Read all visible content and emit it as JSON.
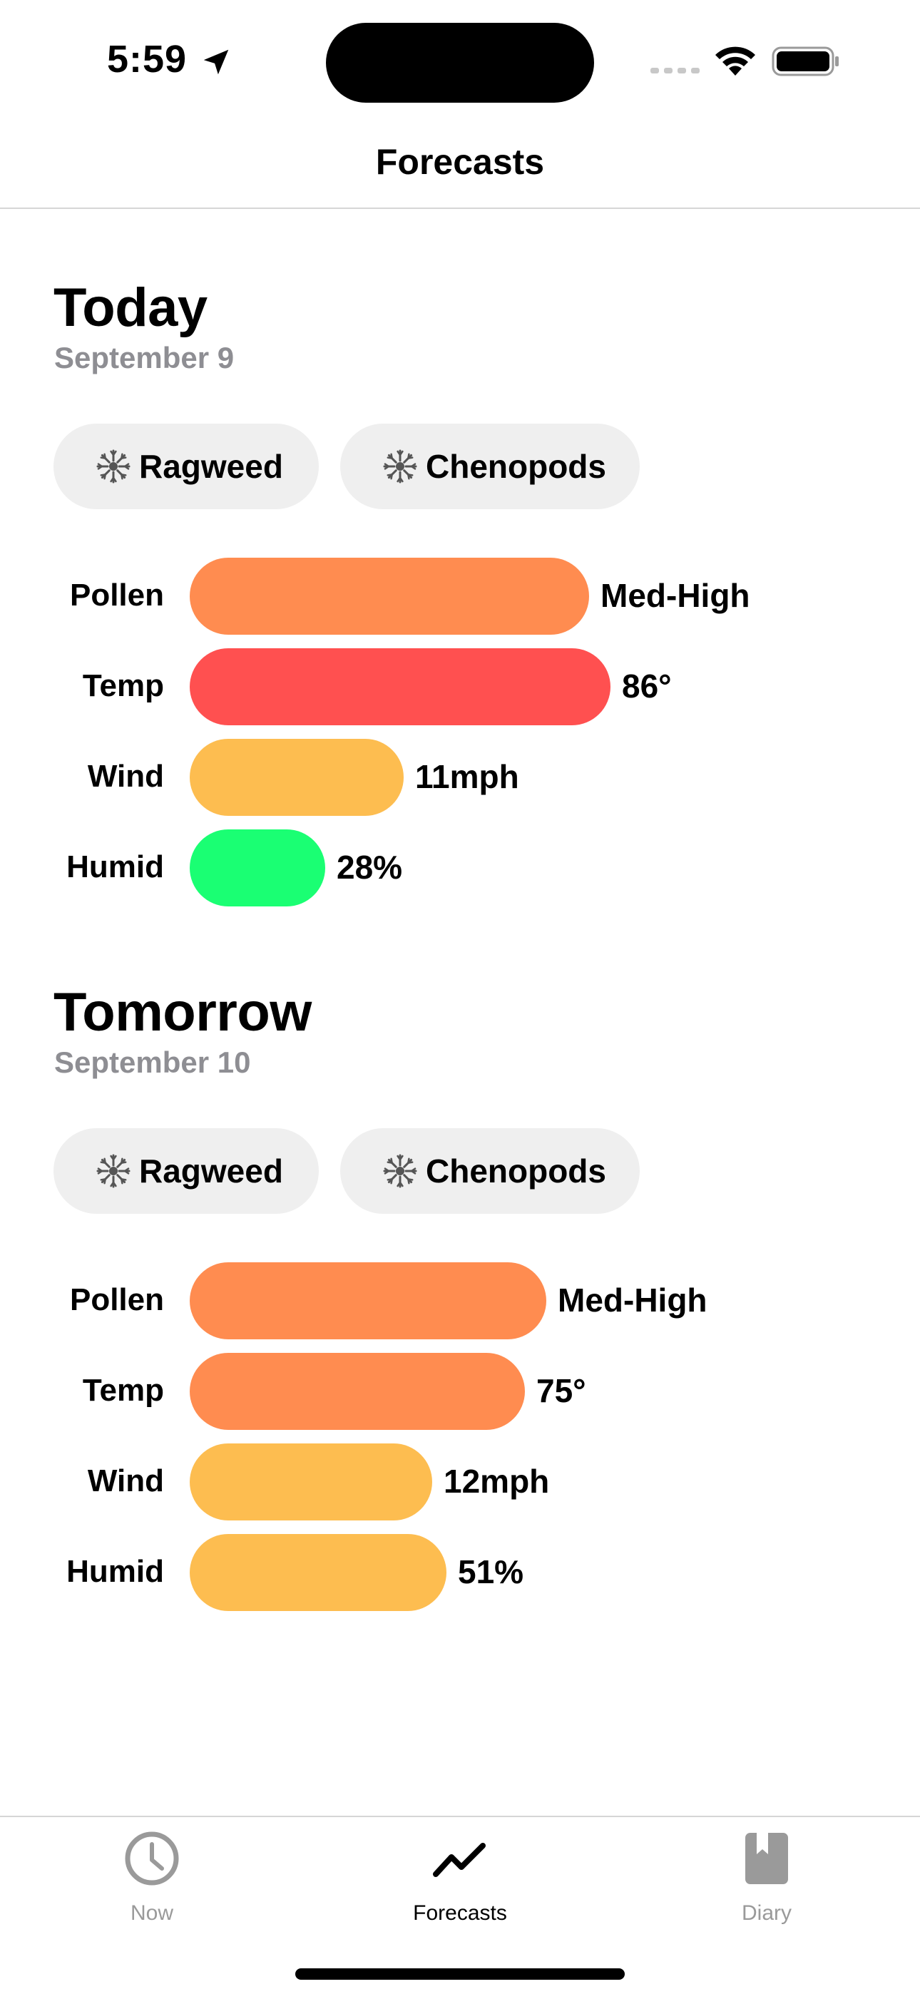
{
  "status_bar": {
    "time": "5:59",
    "icons": [
      "location-arrow-icon",
      "cellular-signal-icon",
      "wifi-icon",
      "battery-icon"
    ]
  },
  "nav": {
    "title": "Forecasts"
  },
  "today": {
    "title": "Today",
    "date": "September 9",
    "allergens": [
      {
        "label": "Ragweed",
        "icon": "pollen-icon"
      },
      {
        "label": "Chenopods",
        "icon": "pollen-icon"
      }
    ],
    "metrics": [
      {
        "label": "Pollen",
        "value": "Med-High",
        "level": 0.56,
        "color": "#FF8C50"
      },
      {
        "label": "Temp",
        "value": "86°",
        "level": 0.59,
        "color": "#FF5050"
      },
      {
        "label": "Wind",
        "value": "11mph",
        "level": 0.3,
        "color": "#FDBD50"
      },
      {
        "label": "Humid",
        "value": "28%",
        "level": 0.19,
        "color": "#1AFF73"
      }
    ]
  },
  "tomorrow": {
    "title": "Tomorrow",
    "date": "September 10",
    "allergens": [
      {
        "label": "Ragweed",
        "icon": "pollen-icon"
      },
      {
        "label": "Chenopods",
        "icon": "pollen-icon"
      }
    ],
    "metrics": [
      {
        "label": "Pollen",
        "value": "Med-High",
        "level": 0.5,
        "color": "#FF8C50"
      },
      {
        "label": "Temp",
        "value": "75°",
        "level": 0.47,
        "color": "#FF8C50"
      },
      {
        "label": "Wind",
        "value": "12mph",
        "level": 0.34,
        "color": "#FDBD50"
      },
      {
        "label": "Humid",
        "value": "51%",
        "level": 0.36,
        "color": "#FDBD50"
      }
    ]
  },
  "tab_bar": {
    "tabs": [
      {
        "label": "Now",
        "icon": "clock-icon",
        "active": false
      },
      {
        "label": "Forecasts",
        "icon": "chart-line-icon",
        "active": true
      },
      {
        "label": "Diary",
        "icon": "book-icon",
        "active": false
      }
    ],
    "active_color": "#000000",
    "inactive_color": "#9a9a9a"
  }
}
